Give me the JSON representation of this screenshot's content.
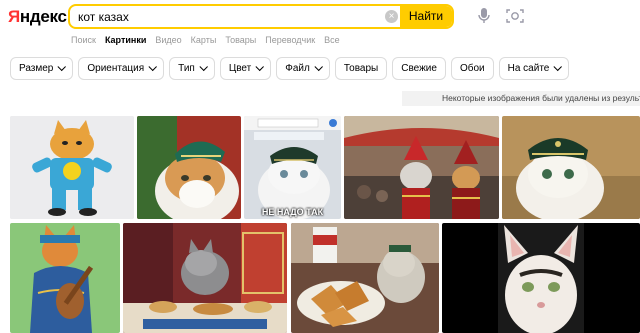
{
  "logo": {
    "first": "Я",
    "rest": "ндекс"
  },
  "search": {
    "query": "кот казах",
    "button_label": "Найти",
    "clear_glyph": "×"
  },
  "tabs": [
    {
      "label": "Поиск",
      "active": false
    },
    {
      "label": "Картинки",
      "active": true
    },
    {
      "label": "Видео",
      "active": false
    },
    {
      "label": "Карты",
      "active": false
    },
    {
      "label": "Товары",
      "active": false
    },
    {
      "label": "Переводчик",
      "active": false
    },
    {
      "label": "Все",
      "active": false
    }
  ],
  "filters": [
    {
      "label": "Размер",
      "dropdown": true
    },
    {
      "label": "Ориентация",
      "dropdown": true
    },
    {
      "label": "Тип",
      "dropdown": true
    },
    {
      "label": "Цвет",
      "dropdown": true
    },
    {
      "label": "Файл",
      "dropdown": true
    },
    {
      "label": "Товары",
      "dropdown": false
    },
    {
      "label": "Свежие",
      "dropdown": false
    },
    {
      "label": "Обои",
      "dropdown": false
    },
    {
      "label": "На сайте",
      "dropdown": true
    }
  ],
  "notice": "Некоторые изображения были удалены из результатов",
  "icons": {
    "mic": "microphone-icon",
    "camera": "camera-search-icon"
  },
  "colors": {
    "accent": "#ffcc00",
    "logo_red": "#ff3333"
  },
  "images": [
    {
      "name": "kazakh-tracksuit-cat",
      "caption": ""
    },
    {
      "name": "cat-in-tubeteika",
      "caption": ""
    },
    {
      "name": "meme-cat-ne-nado-tak",
      "caption": "НЕ НАДО ТАК"
    },
    {
      "name": "cats-in-national-costume",
      "caption": ""
    },
    {
      "name": "cat-in-tubeteika-2",
      "caption": ""
    },
    {
      "name": "cat-playing-dombra",
      "caption": ""
    },
    {
      "name": "grey-cat-at-feast",
      "caption": ""
    },
    {
      "name": "cat-with-samsa",
      "caption": ""
    },
    {
      "name": "cat-with-unibrow",
      "caption": ""
    }
  ]
}
